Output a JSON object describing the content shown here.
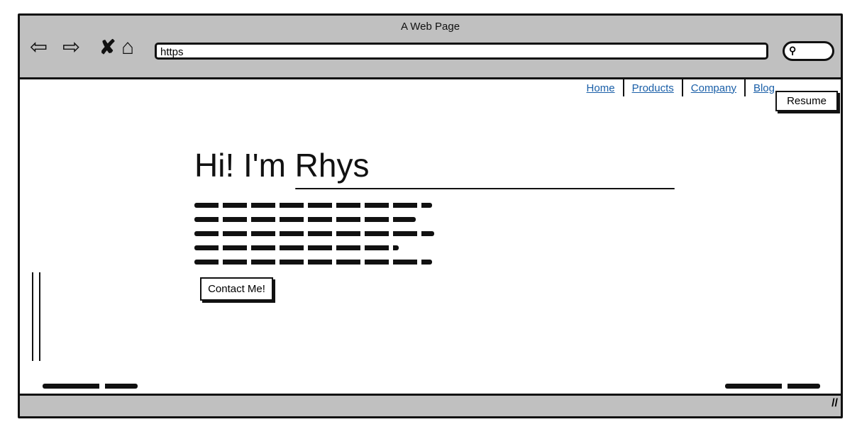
{
  "browser": {
    "title": "A Web Page",
    "url": "https",
    "icons": [
      "back-arrow-icon",
      "forward-arrow-icon",
      "close-icon",
      "home-icon",
      "search-icon"
    ]
  },
  "nav": {
    "links": [
      "Home",
      "Products",
      "Company",
      "Blog"
    ],
    "resume_label": "Resume"
  },
  "hero": {
    "heading": "Hi! I'm Rhys",
    "button_label": "Contact Me!"
  }
}
